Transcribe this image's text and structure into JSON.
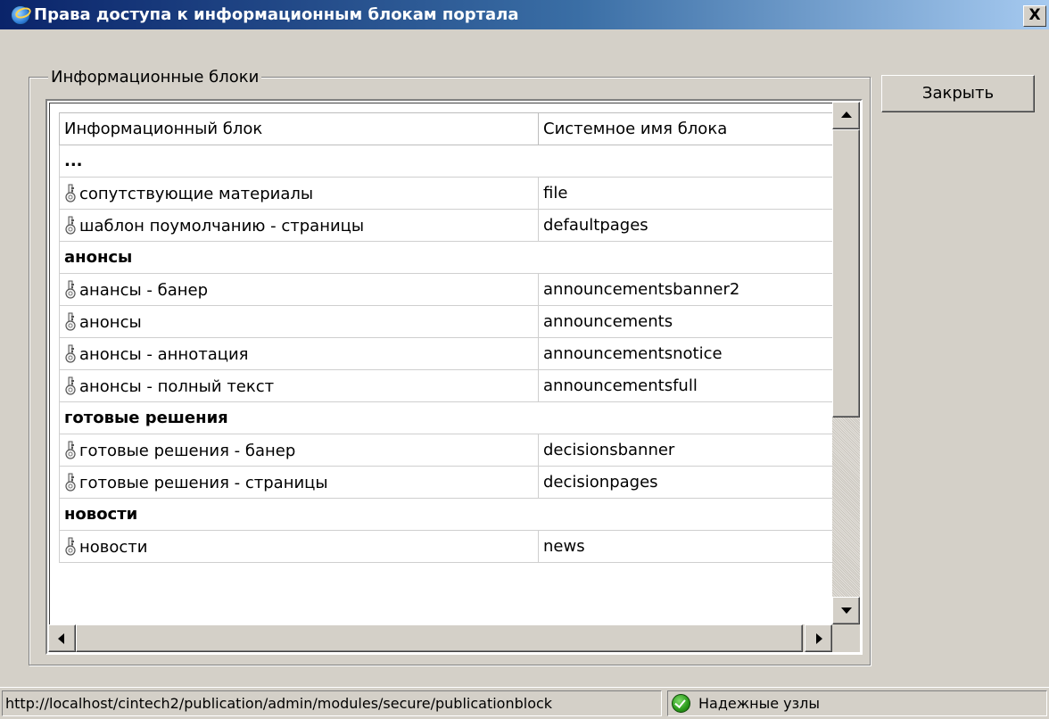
{
  "window": {
    "title": "Права доступа к информационным блокам портала",
    "close_glyph": "X"
  },
  "groupbox": {
    "legend": "Информационные блоки"
  },
  "buttons": {
    "close_label": "Закрыть"
  },
  "table": {
    "headers": [
      "Информационный блок",
      "Системное имя блока"
    ],
    "rows": [
      {
        "kind": "group",
        "label": "..."
      },
      {
        "kind": "item",
        "name": "сопутствующие материалы",
        "system": "file",
        "icon": "key-icon"
      },
      {
        "kind": "item",
        "name": "шаблон поумолчанию - страницы",
        "system": "defaultpages",
        "icon": "key-icon"
      },
      {
        "kind": "group",
        "label": "анонсы"
      },
      {
        "kind": "item",
        "name": "анансы - банер",
        "system": "announcementsbanner2",
        "icon": "key-icon"
      },
      {
        "kind": "item",
        "name": "анонсы",
        "system": "announcements",
        "icon": "key-icon"
      },
      {
        "kind": "item",
        "name": "анонсы - аннотация",
        "system": "announcementsnotice",
        "icon": "key-icon"
      },
      {
        "kind": "item",
        "name": "анонсы - полный текст",
        "system": "announcementsfull",
        "icon": "key-icon"
      },
      {
        "kind": "group",
        "label": "готовые решения"
      },
      {
        "kind": "item",
        "name": "готовые решения - банер",
        "system": "decisionsbanner",
        "icon": "key-icon"
      },
      {
        "kind": "item",
        "name": "готовые решения - страницы",
        "system": "decisionpages",
        "icon": "key-icon"
      },
      {
        "kind": "group",
        "label": "новости"
      },
      {
        "kind": "item",
        "name": "новости",
        "system": "news",
        "icon": "key-icon"
      }
    ]
  },
  "statusbar": {
    "url": "http://localhost/cintech2/publication/admin/modules/secure/publicationblock",
    "zone": "Надежные узлы",
    "zone_icon": "checkmark-icon"
  },
  "colors": {
    "title_start": "#0a246a",
    "title_end": "#a6caf0",
    "face": "#d4d0c8"
  }
}
